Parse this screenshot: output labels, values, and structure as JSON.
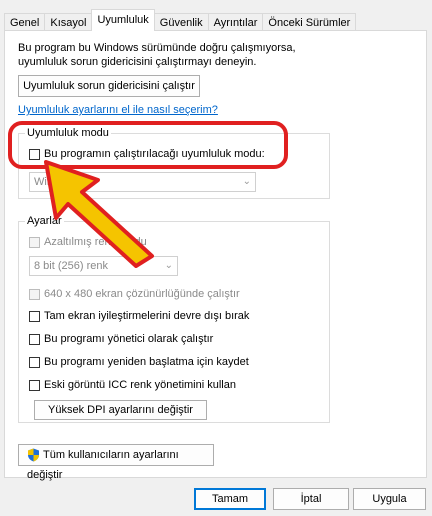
{
  "tabs": [
    {
      "label": "Genel"
    },
    {
      "label": "Kısayol"
    },
    {
      "label": "Uyumluluk"
    },
    {
      "label": "Güvenlik"
    },
    {
      "label": "Ayrıntılar"
    },
    {
      "label": "Önceki Sürümler"
    }
  ],
  "active_tab": "Uyumluluk",
  "intro_text": "Bu program bu Windows sürümünde doğru çalışmıyorsa, uyumluluk sorun gidericisini çalıştırmayı deneyin.",
  "troubleshooter_button": "Uyumluluk sorun gidericisini çalıştır",
  "manual_link": "Uyumluluk ayarlarını el ile nasıl seçerim?",
  "compat_mode": {
    "group_title": "Uyumluluk modu",
    "checkbox_label": "Bu programın çalıştırılacağı uyumluluk modu:",
    "checked": false,
    "select_value": "Windo"
  },
  "settings": {
    "group_title": "Ayarlar",
    "reduced_color_label": "Azaltılmış renk modu",
    "color_select_value": "8 bit (256) renk",
    "low_res_label": "640 x 480 ekran çözünürlüğünde çalıştır",
    "disable_fullscreen_label": "Tam ekran iyileştirmelerini devre dışı bırak",
    "run_as_admin_label": "Bu programı yönetici olarak çalıştır",
    "register_restart_label": "Bu programı yeniden başlatma için kaydet",
    "legacy_icc_label": "Eski görüntü ICC renk yönetimini kullan",
    "high_dpi_button": "Yüksek DPI ayarlarını değiştir"
  },
  "all_users_button": "Tüm kullanıcıların ayarlarını değiştir",
  "footer": {
    "ok": "Tamam",
    "cancel": "İptal",
    "apply": "Uygula"
  },
  "colors": {
    "highlight": "#e02020",
    "arrow_fill": "#f5c400",
    "arrow_stroke": "#e02020",
    "link": "#0066cc"
  }
}
